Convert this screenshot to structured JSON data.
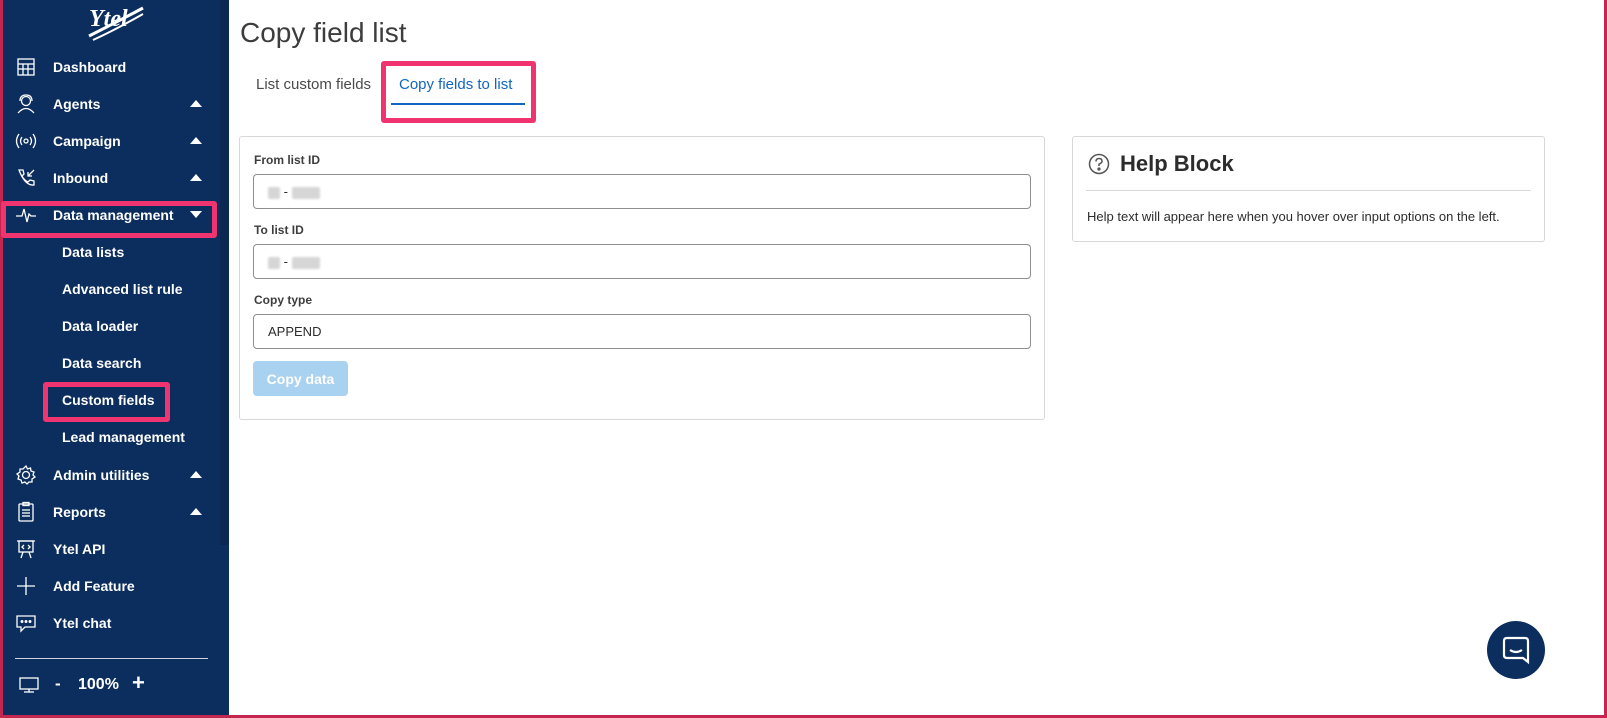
{
  "app": {
    "logo_text": "Ytel"
  },
  "sidebar": {
    "items": [
      {
        "label": "Dashboard",
        "icon": "dashboard-icon"
      },
      {
        "label": "Agents",
        "icon": "agent-icon",
        "caret": "up"
      },
      {
        "label": "Campaign",
        "icon": "broadcast-icon",
        "caret": "up"
      },
      {
        "label": "Inbound",
        "icon": "inbound-call-icon",
        "caret": "up"
      },
      {
        "label": "Data management",
        "icon": "pulse-icon",
        "caret": "down"
      },
      {
        "label": "Admin utilities",
        "icon": "gear-icon",
        "caret": "up"
      },
      {
        "label": "Reports",
        "icon": "clipboard-icon",
        "caret": "up"
      },
      {
        "label": "Ytel API",
        "icon": "api-icon"
      },
      {
        "label": "Add Feature",
        "icon": "plus-icon"
      },
      {
        "label": "Ytel chat",
        "icon": "chat-icon"
      }
    ],
    "sub_items": [
      {
        "label": "Data lists"
      },
      {
        "label": "Advanced list rule"
      },
      {
        "label": "Data loader"
      },
      {
        "label": "Data search"
      },
      {
        "label": "Custom fields"
      },
      {
        "label": "Lead management"
      }
    ],
    "zoom": {
      "minus": "-",
      "value": "100%",
      "plus": "+"
    }
  },
  "main": {
    "title": "Copy field list",
    "tabs": [
      {
        "label": "List custom fields",
        "active": false
      },
      {
        "label": "Copy fields to list",
        "active": true
      }
    ],
    "form": {
      "from_label": "From list ID",
      "from_sep": "-",
      "to_label": "To list ID",
      "to_sep": "-",
      "copy_type_label": "Copy type",
      "copy_type_value": "APPEND",
      "submit_label": "Copy data"
    },
    "help": {
      "title": "Help Block",
      "text": "Help text will appear here when you hover over input options on the left."
    }
  },
  "colors": {
    "sidebar_bg": "#0b2e5e",
    "accent": "#1266c1",
    "highlight": "#f0346f",
    "button_disabled": "#a9d1f0"
  }
}
